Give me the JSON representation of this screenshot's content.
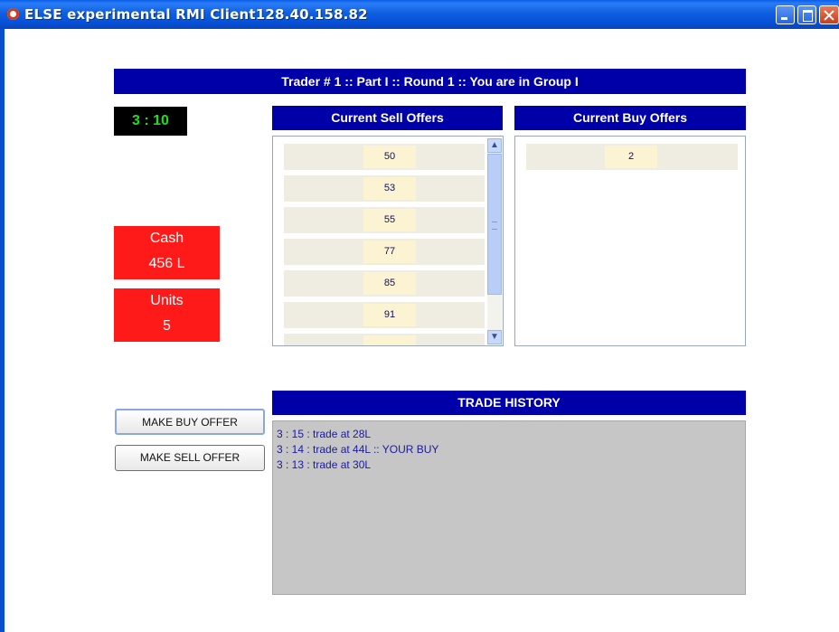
{
  "window": {
    "title": "ELSE experimental RMI Client128.40.158.82"
  },
  "banner": "Trader # 1 :: Part I :: Round 1 :: You are in Group I",
  "timer": "3 : 10",
  "sell_offers": {
    "header": "Current Sell Offers",
    "values": [
      "50",
      "53",
      "55",
      "77",
      "85",
      "91",
      ""
    ]
  },
  "buy_offers": {
    "header": "Current Buy Offers",
    "values": [
      "2"
    ]
  },
  "cash": {
    "label": "Cash",
    "value": "456 L"
  },
  "units": {
    "label": "Units",
    "value": "5"
  },
  "buttons": {
    "buy": "MAKE BUY OFFER",
    "sell": "MAKE SELL OFFER"
  },
  "history": {
    "header": "TRADE HISTORY",
    "lines": [
      "3 : 15 : trade at 28L",
      "3 : 14 : trade at 44L :: YOUR BUY",
      "3 : 13 : trade at 30L"
    ]
  },
  "colors": {
    "header_bg": "#0000a8",
    "stat_bg": "#ff1a1a",
    "timer_text": "#19e019"
  }
}
